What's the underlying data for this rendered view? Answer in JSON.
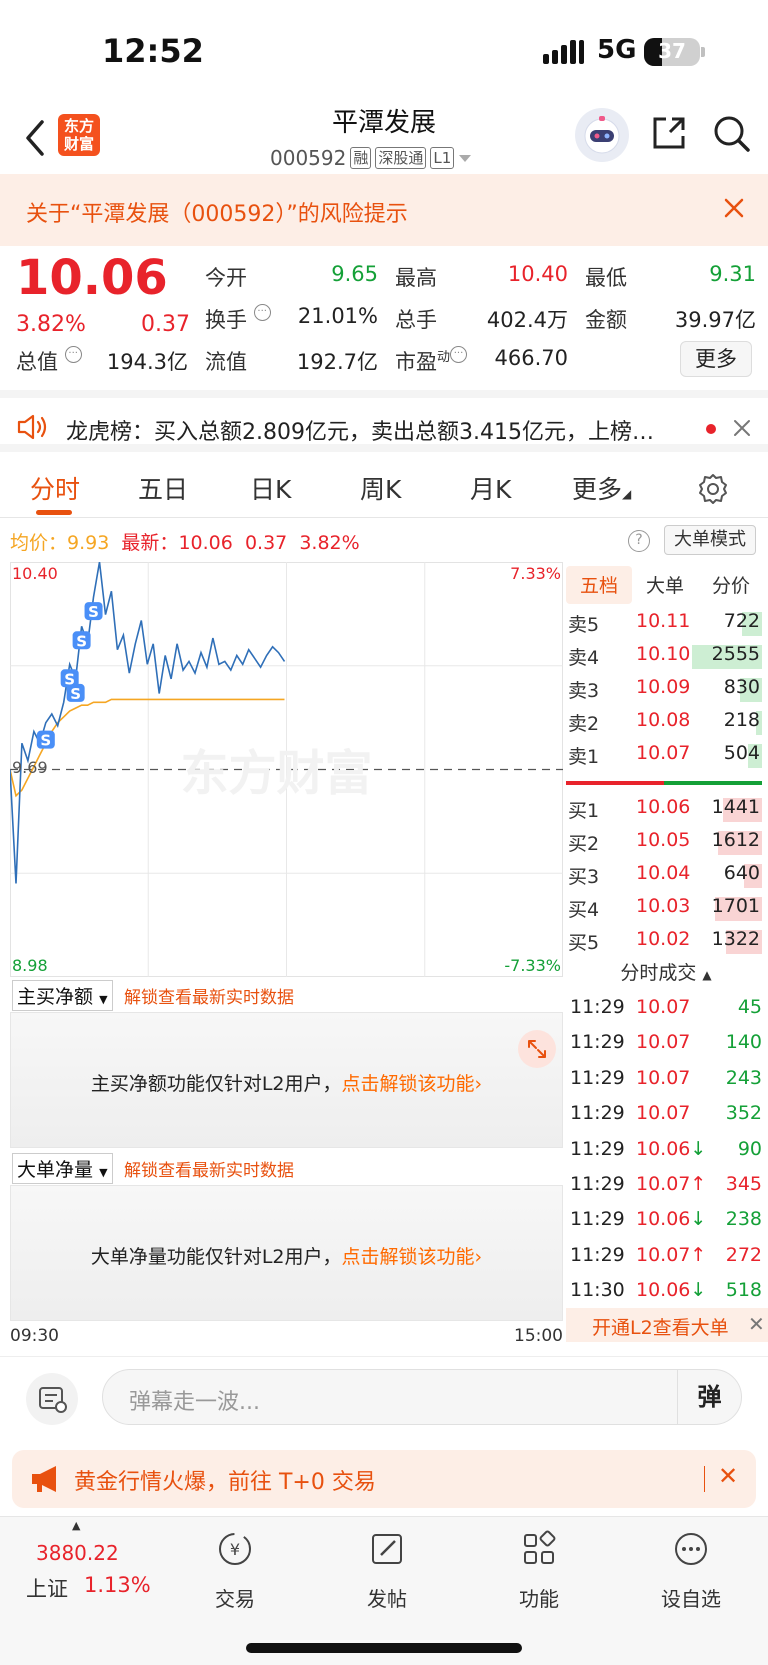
{
  "status_bar": {
    "time": "12:52",
    "network": "5G",
    "battery": "37"
  },
  "header": {
    "title": "平潭发展",
    "code": "000592",
    "tags": [
      "融",
      "深股通",
      "L1"
    ],
    "logo_text": "东方财富"
  },
  "risk_banner": {
    "text": "关于“平潭发展（000592）”的风险提示"
  },
  "quote": {
    "price": "10.06",
    "pct": "3.82%",
    "change": "0.37",
    "rows": [
      [
        {
          "l": "今开",
          "v": "9.65",
          "c": "green"
        },
        {
          "l": "最高",
          "v": "10.40",
          "c": "red"
        },
        {
          "l": "最低",
          "v": "9.31",
          "c": "green"
        }
      ],
      [
        {
          "l": "换手",
          "v": "21.01%",
          "c": ""
        },
        {
          "l": "总手",
          "v": "402.4万",
          "c": ""
        },
        {
          "l": "金额",
          "v": "39.97亿",
          "c": ""
        }
      ]
    ],
    "total_cap_label": "总值",
    "total_cap": "194.3亿",
    "float_cap_label": "流值",
    "float_cap": "192.7亿",
    "pe_label": "市盈",
    "pe_sup": "动",
    "pe": "466.70",
    "more_label": "更多"
  },
  "dragon": {
    "text": "龙虎榜：买入总额2.809亿元，卖出总额3.415亿元，上榜…"
  },
  "tabs": [
    "分时",
    "五日",
    "日K",
    "周K",
    "月K",
    "更多"
  ],
  "avg_line": {
    "avg_label": "均价：",
    "avg": "9.93",
    "latest_label": "最新：",
    "latest": "10.06",
    "chg": "0.37",
    "pct": "3.82%"
  },
  "big_mode": "大单模式",
  "chart_data": {
    "type": "line",
    "y_high": "10.40",
    "y_low": "8.98",
    "y_prev": "9.69",
    "pct_high": "7.33%",
    "pct_low": "-7.33%",
    "x_start": "09:30",
    "x_end": "15:00",
    "ylim": [
      8.98,
      10.4
    ],
    "prev_close": 9.69,
    "series": [
      {
        "values": [
          9.69,
          9.3,
          9.78,
          9.72,
          9.82,
          9.78,
          9.85,
          9.88,
          9.84,
          9.92,
          10.05,
          10.0,
          10.18,
          10.12,
          10.28,
          10.4,
          10.22,
          10.3,
          10.1,
          10.15,
          10.02,
          10.12,
          10.2,
          10.05,
          10.12,
          9.95,
          10.08,
          10.0,
          10.12,
          10.03,
          10.06,
          10.02,
          10.09,
          10.04,
          10.14,
          10.05,
          10.06,
          10.03,
          10.08,
          10.05,
          10.1,
          10.07,
          10.04,
          10.08,
          10.11,
          10.09,
          10.06
        ]
      },
      {
        "values": [
          9.69,
          9.6,
          9.62,
          9.66,
          9.7,
          9.74,
          9.78,
          9.82,
          9.85,
          9.87,
          9.89,
          9.9,
          9.91,
          9.91,
          9.92,
          9.92,
          9.92,
          9.93,
          9.93,
          9.93,
          9.93,
          9.93,
          9.93,
          9.93,
          9.93,
          9.93,
          9.93,
          9.93,
          9.93,
          9.93,
          9.93,
          9.93,
          9.93,
          9.93,
          9.93,
          9.93,
          9.93,
          9.93,
          9.93,
          9.93,
          9.93,
          9.93,
          9.93,
          9.93,
          9.93,
          9.93,
          9.93
        ]
      }
    ]
  },
  "watermark": "东方财富",
  "order_book": {
    "tabs": [
      "五档",
      "大单",
      "分价"
    ],
    "asks": [
      {
        "l": "卖5",
        "p": "10.11",
        "v": "722",
        "w": 0.28
      },
      {
        "l": "卖4",
        "p": "10.10",
        "v": "2555",
        "w": 1.0
      },
      {
        "l": "卖3",
        "p": "10.09",
        "v": "830",
        "w": 0.32
      },
      {
        "l": "卖2",
        "p": "10.08",
        "v": "218",
        "w": 0.09
      },
      {
        "l": "卖1",
        "p": "10.07",
        "v": "504",
        "w": 0.2
      }
    ],
    "bids": [
      {
        "l": "买1",
        "p": "10.06",
        "v": "1441",
        "w": 0.56
      },
      {
        "l": "买2",
        "p": "10.05",
        "v": "1612",
        "w": 0.63
      },
      {
        "l": "买3",
        "p": "10.04",
        "v": "640",
        "w": 0.25
      },
      {
        "l": "买4",
        "p": "10.03",
        "v": "1701",
        "w": 0.67
      },
      {
        "l": "买5",
        "p": "10.02",
        "v": "1322",
        "w": 0.52
      }
    ]
  },
  "trades_title": "分时成交",
  "trades": [
    {
      "t": "11:29",
      "p": "10.07",
      "v": "45",
      "d": "",
      "c": "green"
    },
    {
      "t": "11:29",
      "p": "10.07",
      "v": "140",
      "d": "",
      "c": "green"
    },
    {
      "t": "11:29",
      "p": "10.07",
      "v": "243",
      "d": "",
      "c": "green"
    },
    {
      "t": "11:29",
      "p": "10.07",
      "v": "352",
      "d": "",
      "c": "green"
    },
    {
      "t": "11:29",
      "p": "10.06",
      "v": "90",
      "d": "↓",
      "c": "green"
    },
    {
      "t": "11:29",
      "p": "10.07",
      "v": "345",
      "d": "↑",
      "c": "red"
    },
    {
      "t": "11:29",
      "p": "10.06",
      "v": "238",
      "d": "↓",
      "c": "green"
    },
    {
      "t": "11:29",
      "p": "10.07",
      "v": "272",
      "d": "↑",
      "c": "red"
    },
    {
      "t": "11:30",
      "p": "10.06",
      "v": "518",
      "d": "↓",
      "c": "green"
    }
  ],
  "l2_promo": "开通L2查看大单",
  "indicators": [
    {
      "select": "主买净额",
      "link": "解锁查看最新实时数据",
      "msg": "主买净额功能仅针对L2用户，",
      "action": "点击解锁该功能"
    },
    {
      "select": "大单净量",
      "link": "解锁查看最新实时数据",
      "msg": "大单净量功能仅针对L2用户，",
      "action": "点击解锁该功能"
    }
  ],
  "comment": {
    "placeholder": "弹幕走一波...",
    "danmu": "弹"
  },
  "gold_banner": "黄金行情火爆，前往 T+0 交易",
  "nav": {
    "index_value": "3880.22",
    "index_name": "上证",
    "index_pct": "1.13%",
    "items": [
      "交易",
      "发帖",
      "功能",
      "设自选"
    ]
  },
  "colors": {
    "up": "#e8232b",
    "down": "#14a037",
    "accent": "#e8510f",
    "price_line": "#2f6fb8",
    "avg_line": "#f5a623"
  }
}
